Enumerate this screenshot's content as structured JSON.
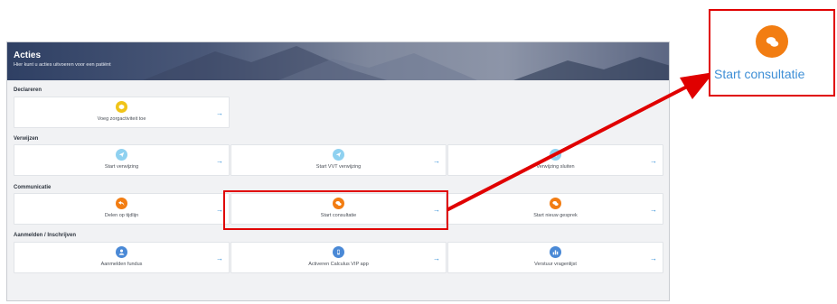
{
  "header": {
    "title": "Acties",
    "subtitle": "Hier kunt u acties uitvoeren voor een patiënt"
  },
  "sections": [
    {
      "label": "Declareren",
      "cards": [
        {
          "label": "Voeg zorgactiviteit toe",
          "icon": "cube-icon",
          "color": "#f0c419"
        }
      ]
    },
    {
      "label": "Verwijzen",
      "cards": [
        {
          "label": "Start verwijzing",
          "icon": "send-icon",
          "color": "#8fd1f0"
        },
        {
          "label": "Start VVT verwijzing",
          "icon": "send-icon",
          "color": "#8fd1f0"
        },
        {
          "label": "Verwijzing sluiten",
          "icon": "send-icon",
          "color": "#8fd1f0"
        }
      ]
    },
    {
      "label": "Communicatie",
      "cards": [
        {
          "label": "Delen op tijdlijn",
          "icon": "share-icon",
          "color": "#f27d12"
        },
        {
          "label": "Start consultatie",
          "icon": "chat-icon",
          "color": "#f27d12"
        },
        {
          "label": "Start nieuw gesprek",
          "icon": "chat-icon",
          "color": "#f27d12"
        }
      ]
    },
    {
      "label": "Aanmelden / Inschrijven",
      "cards": [
        {
          "label": "Aanmelden fundus",
          "icon": "user-icon",
          "color": "#4a89d6"
        },
        {
          "label": "Activeren Calculus VIP app",
          "icon": "mobile-icon",
          "color": "#4a89d6"
        },
        {
          "label": "Verstuur vragenlijst",
          "icon": "bar-chart-icon",
          "color": "#4a89d6"
        }
      ]
    }
  ],
  "arrow_glyph": "→",
  "zoom": {
    "label": "Start consultatie",
    "icon": "chat-icon",
    "color": "#f27d12"
  },
  "annotation_color": "#e00000"
}
